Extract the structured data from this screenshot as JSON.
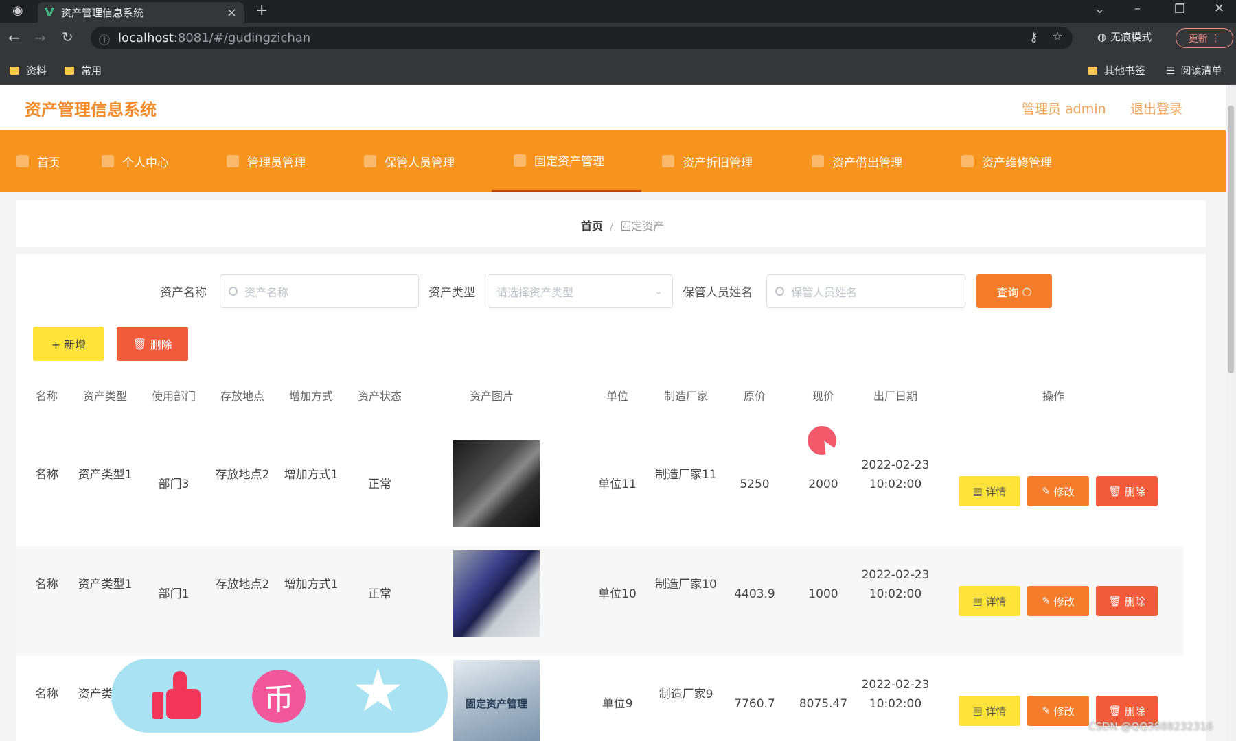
{
  "browser": {
    "tab_title": "资产管理信息系统",
    "url_host": "localhost",
    "url_path": ":8081/#/gudingzichan",
    "incognito_label": "无痕模式",
    "update_label": "更新",
    "bookmarks": [
      "资料",
      "常用"
    ],
    "other_bookmarks": "其他书签",
    "reading_list": "阅读清单"
  },
  "app": {
    "title": "资产管理信息系统",
    "admin": "管理员 admin",
    "logout": "退出登录"
  },
  "nav": [
    "首页",
    "个人中心",
    "管理员管理",
    "保管人员管理",
    "固定资产管理",
    "资产折旧管理",
    "资产借出管理",
    "资产维修管理"
  ],
  "breadcrumb": {
    "home": "首页",
    "current": "固定资产"
  },
  "search": {
    "name_label": "资产名称",
    "name_placeholder": "资产名称",
    "type_label": "资产类型",
    "type_placeholder": "请选择资产类型",
    "keeper_label": "保管人员姓名",
    "keeper_placeholder": "保管人员姓名",
    "query_button": "查询"
  },
  "toolbar": {
    "add_button": "+ 新增",
    "delete_button": "删除"
  },
  "table": {
    "headers": [
      "名称",
      "资产类型",
      "使用部门",
      "存放地点",
      "增加方式",
      "资产状态",
      "资产图片",
      "单位",
      "制造厂家",
      "原价",
      "现价",
      "出厂日期",
      "操作"
    ],
    "rows": [
      {
        "name": "名称",
        "type": "资产类型1",
        "dept": "部门3",
        "location": "存放地点2",
        "method": "增加方式1",
        "status": "正常",
        "unit": "单位11",
        "maker": "制造厂家11",
        "orig": "5250",
        "current": "2000",
        "date": "2022-02-23 10:02:00"
      },
      {
        "name": "名称",
        "type": "资产类型1",
        "dept": "部门1",
        "location": "存放地点2",
        "method": "增加方式1",
        "status": "正常",
        "unit": "单位10",
        "maker": "制造厂家10",
        "orig": "4403.9",
        "current": "1000",
        "date": "2022-02-23 10:02:00"
      },
      {
        "name": "名称",
        "type": "资产类型2",
        "dept": "",
        "location": "",
        "method": "",
        "status": "",
        "unit": "单位9",
        "maker": "制造厂家9",
        "orig": "7760.7",
        "current": "8075.47",
        "date": "2022-02-23 10:02:00",
        "image_text": "固定资产管理"
      }
    ],
    "actions": {
      "detail": "详情",
      "edit": "修改",
      "delete": "删除"
    }
  },
  "watermark": "CSDN @QQ3888232316"
}
